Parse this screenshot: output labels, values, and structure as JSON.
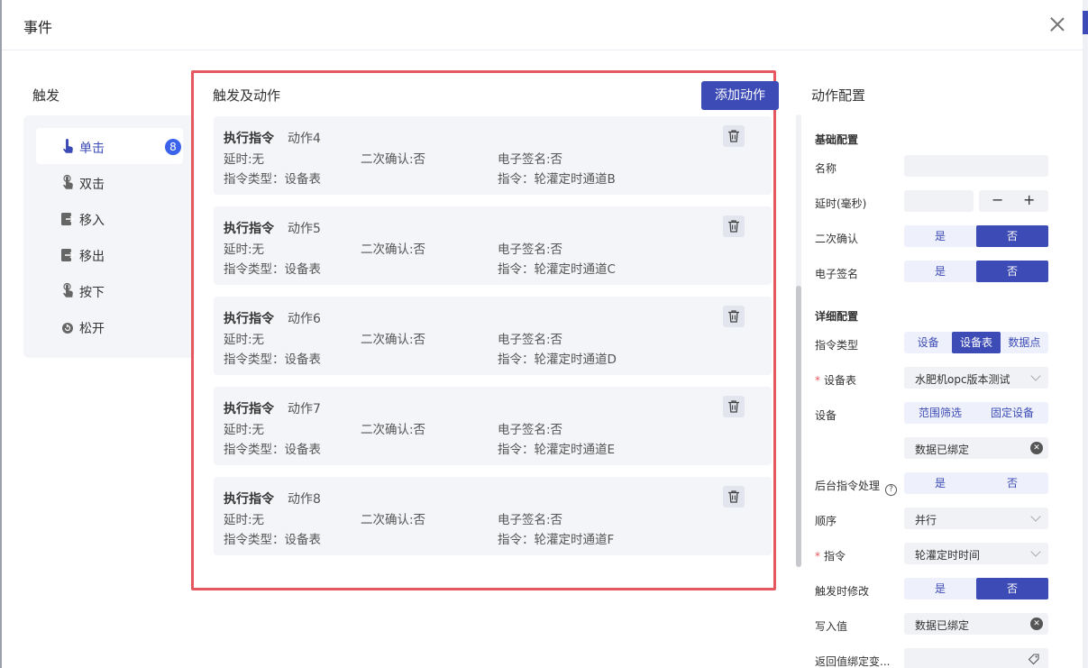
{
  "dialog": {
    "title": "事件"
  },
  "trigger": {
    "title": "触发",
    "items": [
      {
        "label": "单击",
        "badge": "8",
        "active": true,
        "icon": "tap-icon"
      },
      {
        "label": "双击",
        "icon": "double-tap-icon"
      },
      {
        "label": "移入",
        "icon": "move-in-icon"
      },
      {
        "label": "移出",
        "icon": "move-out-icon"
      },
      {
        "label": "按下",
        "icon": "press-icon"
      },
      {
        "label": "松开",
        "icon": "release-icon"
      }
    ]
  },
  "actions": {
    "title": "触发及动作",
    "add_label": "添加动作",
    "cards": [
      {
        "type": "执行指令",
        "name": "动作4",
        "delay": "延时:无",
        "confirm": "二次确认:否",
        "esign": "电子签名:否",
        "cmd_type": "指令类型：设备表",
        "cmd": "指令：轮灌定时通道B"
      },
      {
        "type": "执行指令",
        "name": "动作5",
        "delay": "延时:无",
        "confirm": "二次确认:否",
        "esign": "电子签名:否",
        "cmd_type": "指令类型：设备表",
        "cmd": "指令：轮灌定时通道C"
      },
      {
        "type": "执行指令",
        "name": "动作6",
        "delay": "延时:无",
        "confirm": "二次确认:否",
        "esign": "电子签名:否",
        "cmd_type": "指令类型：设备表",
        "cmd": "指令：轮灌定时通道D"
      },
      {
        "type": "执行指令",
        "name": "动作7",
        "delay": "延时:无",
        "confirm": "二次确认:否",
        "esign": "电子签名:否",
        "cmd_type": "指令类型：设备表",
        "cmd": "指令：轮灌定时通道E"
      },
      {
        "type": "执行指令",
        "name": "动作8",
        "delay": "延时:无",
        "confirm": "二次确认:否",
        "esign": "电子签名:否",
        "cmd_type": "指令类型：设备表",
        "cmd": "指令：轮灌定时通道F"
      }
    ]
  },
  "config": {
    "title": "动作配置",
    "basic_title": "基础配置",
    "name_label": "名称",
    "name_value": "",
    "delay_label": "延时(毫秒)",
    "delay_value": "",
    "stepper_minus": "−",
    "stepper_plus": "+",
    "confirm_label": "二次确认",
    "esign_label": "电子签名",
    "yes": "是",
    "no": "否",
    "detail_title": "详细配置",
    "cmd_type_label": "指令类型",
    "cmd_type_options": [
      "设备",
      "设备表",
      "数据点"
    ],
    "req_mark": "*",
    "device_table_label": "设备表",
    "device_table_value": "水肥机opc版本测试",
    "device_label": "设备",
    "device_options": [
      "范围筛选",
      "固定设备"
    ],
    "bound_value": "数据已绑定",
    "clear_glyph": "✕",
    "backend_label": "后台指令处理",
    "help_glyph": "?",
    "order_label": "顺序",
    "order_value": "并行",
    "cmd_label": "指令",
    "cmd_value": "轮灌定时时间",
    "modify_label": "触发时修改",
    "write_label": "写入值",
    "write_value": "数据已绑定",
    "return_label": "返回值绑定变..."
  }
}
